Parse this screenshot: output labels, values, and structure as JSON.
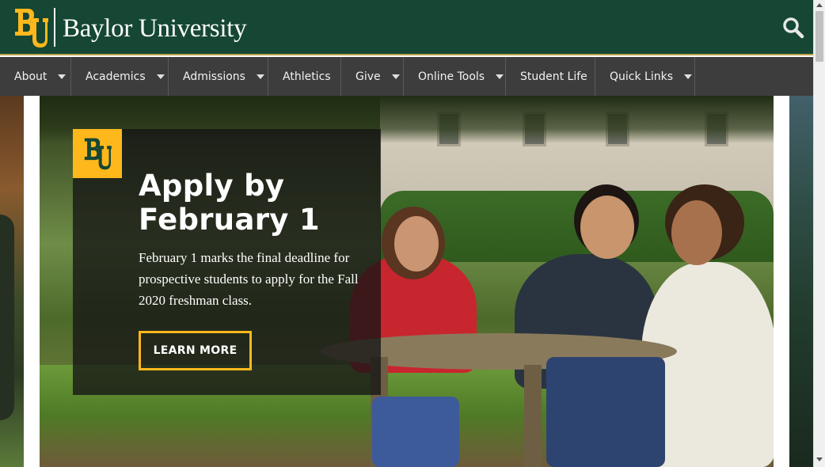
{
  "header": {
    "logo_icon": "baylor-bu-logo",
    "site_name": "Baylor University",
    "search_icon": "search-icon",
    "colors": {
      "brand_green": "#154734",
      "brand_gold": "#ffb81c",
      "nav_bg": "#3d3d3d"
    }
  },
  "nav": {
    "items": [
      {
        "label": "About",
        "has_dropdown": true
      },
      {
        "label": "Academics",
        "has_dropdown": true
      },
      {
        "label": "Admissions",
        "has_dropdown": true
      },
      {
        "label": "Athletics",
        "has_dropdown": false
      },
      {
        "label": "Give",
        "has_dropdown": true
      },
      {
        "label": "Online Tools",
        "has_dropdown": true
      },
      {
        "label": "Student Life",
        "has_dropdown": false
      },
      {
        "label": "Quick Links",
        "has_dropdown": true
      }
    ]
  },
  "hero": {
    "badge_icon": "baylor-bu-logo",
    "title": "Apply by February 1",
    "body": "February 1 marks the final deadline for prospective students to apply for the Fall 2020 freshman class.",
    "cta_label": "LEARN MORE"
  }
}
